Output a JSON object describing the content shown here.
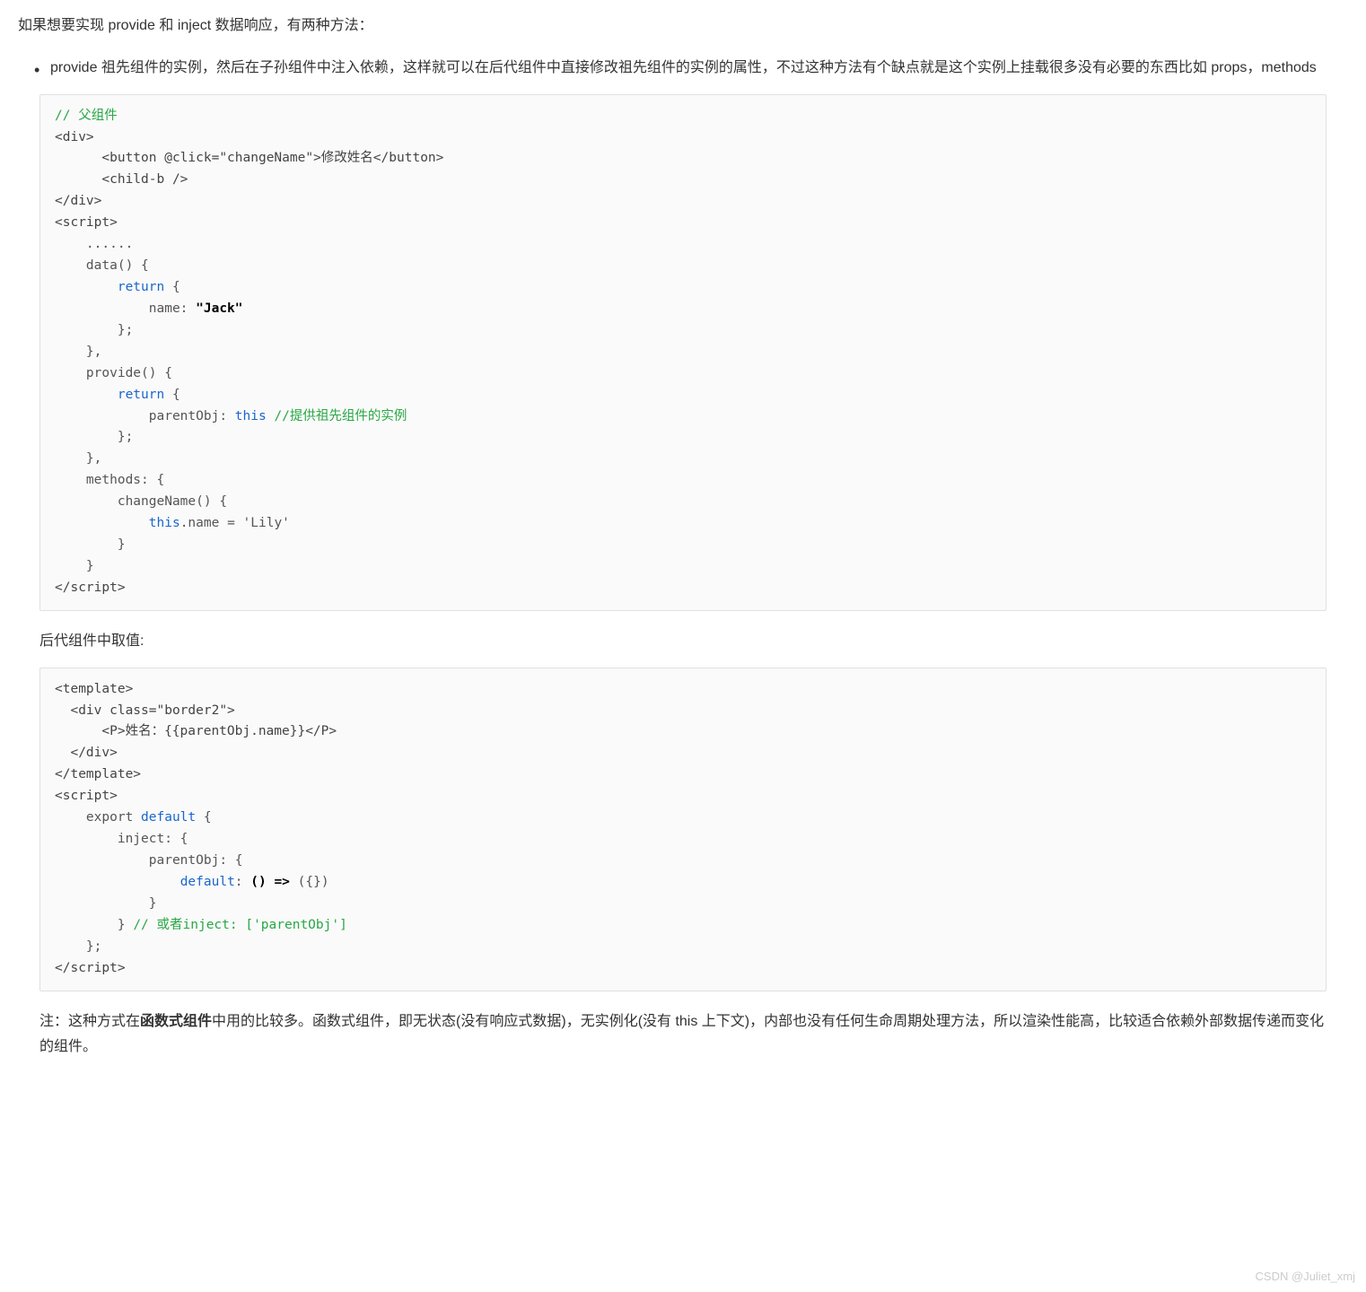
{
  "intro": "如果想要实现 provide 和 inject 数据响应，有两种方法：",
  "bullet1": "provide 祖先组件的实例，然后在子孙组件中注入依赖，这样就可以在后代组件中直接修改祖先组件的实例的属性，不过这种方法有个缺点就是这个实例上挂载很多没有必要的东西比如 props，methods",
  "code1": {
    "c1": "// 父组件",
    "l2": "<div>",
    "l3": "      <button @click=\"changeName\">修改姓名</button>",
    "l4": "      <child-b />",
    "l5": "</div>",
    "l6": "<script>",
    "l7": "    ......",
    "l8": "    data() {",
    "kw1": "return",
    "l9b": " {",
    "l10": "            name: ",
    "s1": "\"Jack\"",
    "l11": "        };",
    "l12": "    },",
    "l13": "    provide() {",
    "kw2": "return",
    "l14b": " {",
    "l15a": "            parentObj: ",
    "kw3": "this",
    "l15b": " ",
    "c2": "//提供祖先组件的实例",
    "l16": "        };",
    "l17": "    },",
    "l18": "    methods: {",
    "l19": "        changeName() {",
    "kw4": "this",
    "l20b": ".name = 'Lily'",
    "l21": "        }",
    "l22": "    }",
    "l23": "</scr",
    "l23b": "ipt>"
  },
  "subheading1": "后代组件中取值:",
  "code2": {
    "l1": "<template>",
    "l2": "  <div class=\"border2\">",
    "l3": "      <P>姓名：{{parentObj.name}}</P>",
    "l4": "  </div>",
    "l5": "</template>",
    "l6": "<script>",
    "l7a": "    export ",
    "kw1": "default",
    "l7b": " {",
    "l8": "        inject: {",
    "l9": "            parentObj: {",
    "kw2": "default",
    "l10b": ": ",
    "bold1": "() =>",
    "l10c": " ({})",
    "l11": "            }",
    "l12a": "        } ",
    "c1": "// 或者inject: ['parentObj']",
    "l13": "    };",
    "l14": "</scr",
    "l14b": "ipt>"
  },
  "note_prefix": "注：这种方式在",
  "note_bold": "函数式组件",
  "note_suffix": "中用的比较多。函数式组件，即无状态(没有响应式数据)，无实例化(没有 this 上下文)，内部也没有任何生命周期处理方法，所以渲染性能高，比较适合依赖外部数据传递而变化的组件。",
  "watermark": "CSDN @Juliet_xmj"
}
